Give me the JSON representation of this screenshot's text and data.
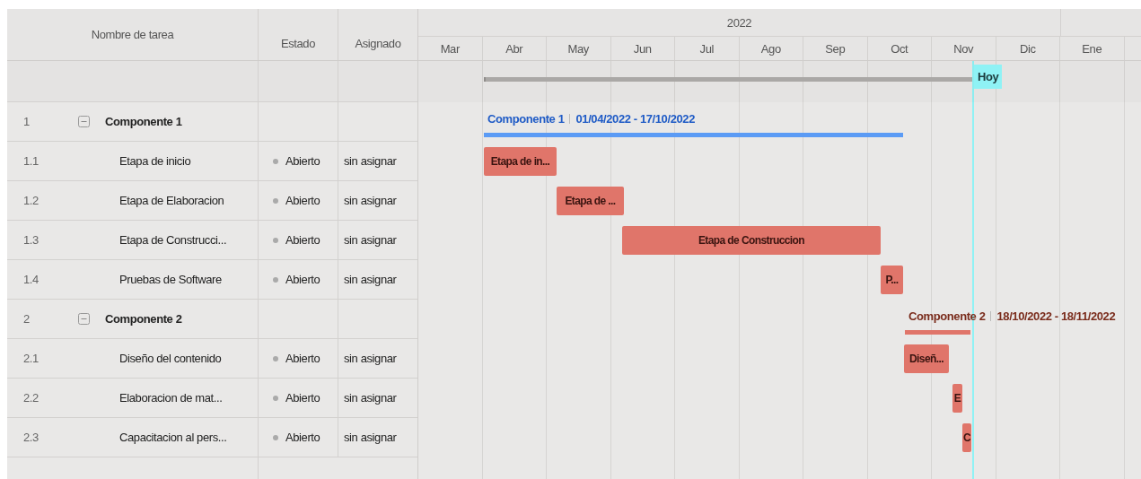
{
  "columns": {
    "name": "Nombre de tarea",
    "status": "Estado",
    "assignee": "Asignado"
  },
  "timeline": {
    "year": "2022",
    "months": [
      "Mar",
      "Abr",
      "May",
      "Jun",
      "Jul",
      "Ago",
      "Sep",
      "Oct",
      "Nov",
      "Dic",
      "Ene"
    ],
    "today": "Hoy"
  },
  "rows": [
    {
      "kind": "group",
      "id": "1",
      "name": "Componente 1",
      "expanded": true,
      "bar": {
        "title": "Componente 1",
        "range": "01/04/2022 - 17/10/2022",
        "color": "#1f5bc6"
      }
    },
    {
      "kind": "task",
      "id": "1.1",
      "name": "Etapa de inicio",
      "status": "Abierto",
      "assignee": "sin asignar",
      "bar": {
        "label": "Etapa de in..."
      }
    },
    {
      "kind": "task",
      "id": "1.2",
      "name": "Etapa de Elaboracion",
      "status": "Abierto",
      "assignee": "sin asignar",
      "bar": {
        "label": "Etapa de ..."
      }
    },
    {
      "kind": "task",
      "id": "1.3",
      "name": "Etapa de Construcci...",
      "status": "Abierto",
      "assignee": "sin asignar",
      "bar": {
        "label": "Etapa de Construccion"
      }
    },
    {
      "kind": "task",
      "id": "1.4",
      "name": "Pruebas de Software",
      "status": "Abierto",
      "assignee": "sin asignar",
      "bar": {
        "label": "P..."
      }
    },
    {
      "kind": "group",
      "id": "2",
      "name": "Componente 2",
      "expanded": true,
      "bar": {
        "title": "Componente 2",
        "range": "18/10/2022 - 18/11/2022",
        "color": "#7a2c1c"
      }
    },
    {
      "kind": "task",
      "id": "2.1",
      "name": "Diseño del contenido",
      "status": "Abierto",
      "assignee": "sin asignar",
      "bar": {
        "label": "Diseñ..."
      }
    },
    {
      "kind": "task",
      "id": "2.2",
      "name": "Elaboracion de mat...",
      "status": "Abierto",
      "assignee": "sin asignar",
      "bar": {
        "label": "E"
      }
    },
    {
      "kind": "task",
      "id": "2.3",
      "name": "Capacitacion al pers...",
      "status": "Abierto",
      "assignee": "sin asignar",
      "bar": {
        "label": "C"
      }
    }
  ]
}
